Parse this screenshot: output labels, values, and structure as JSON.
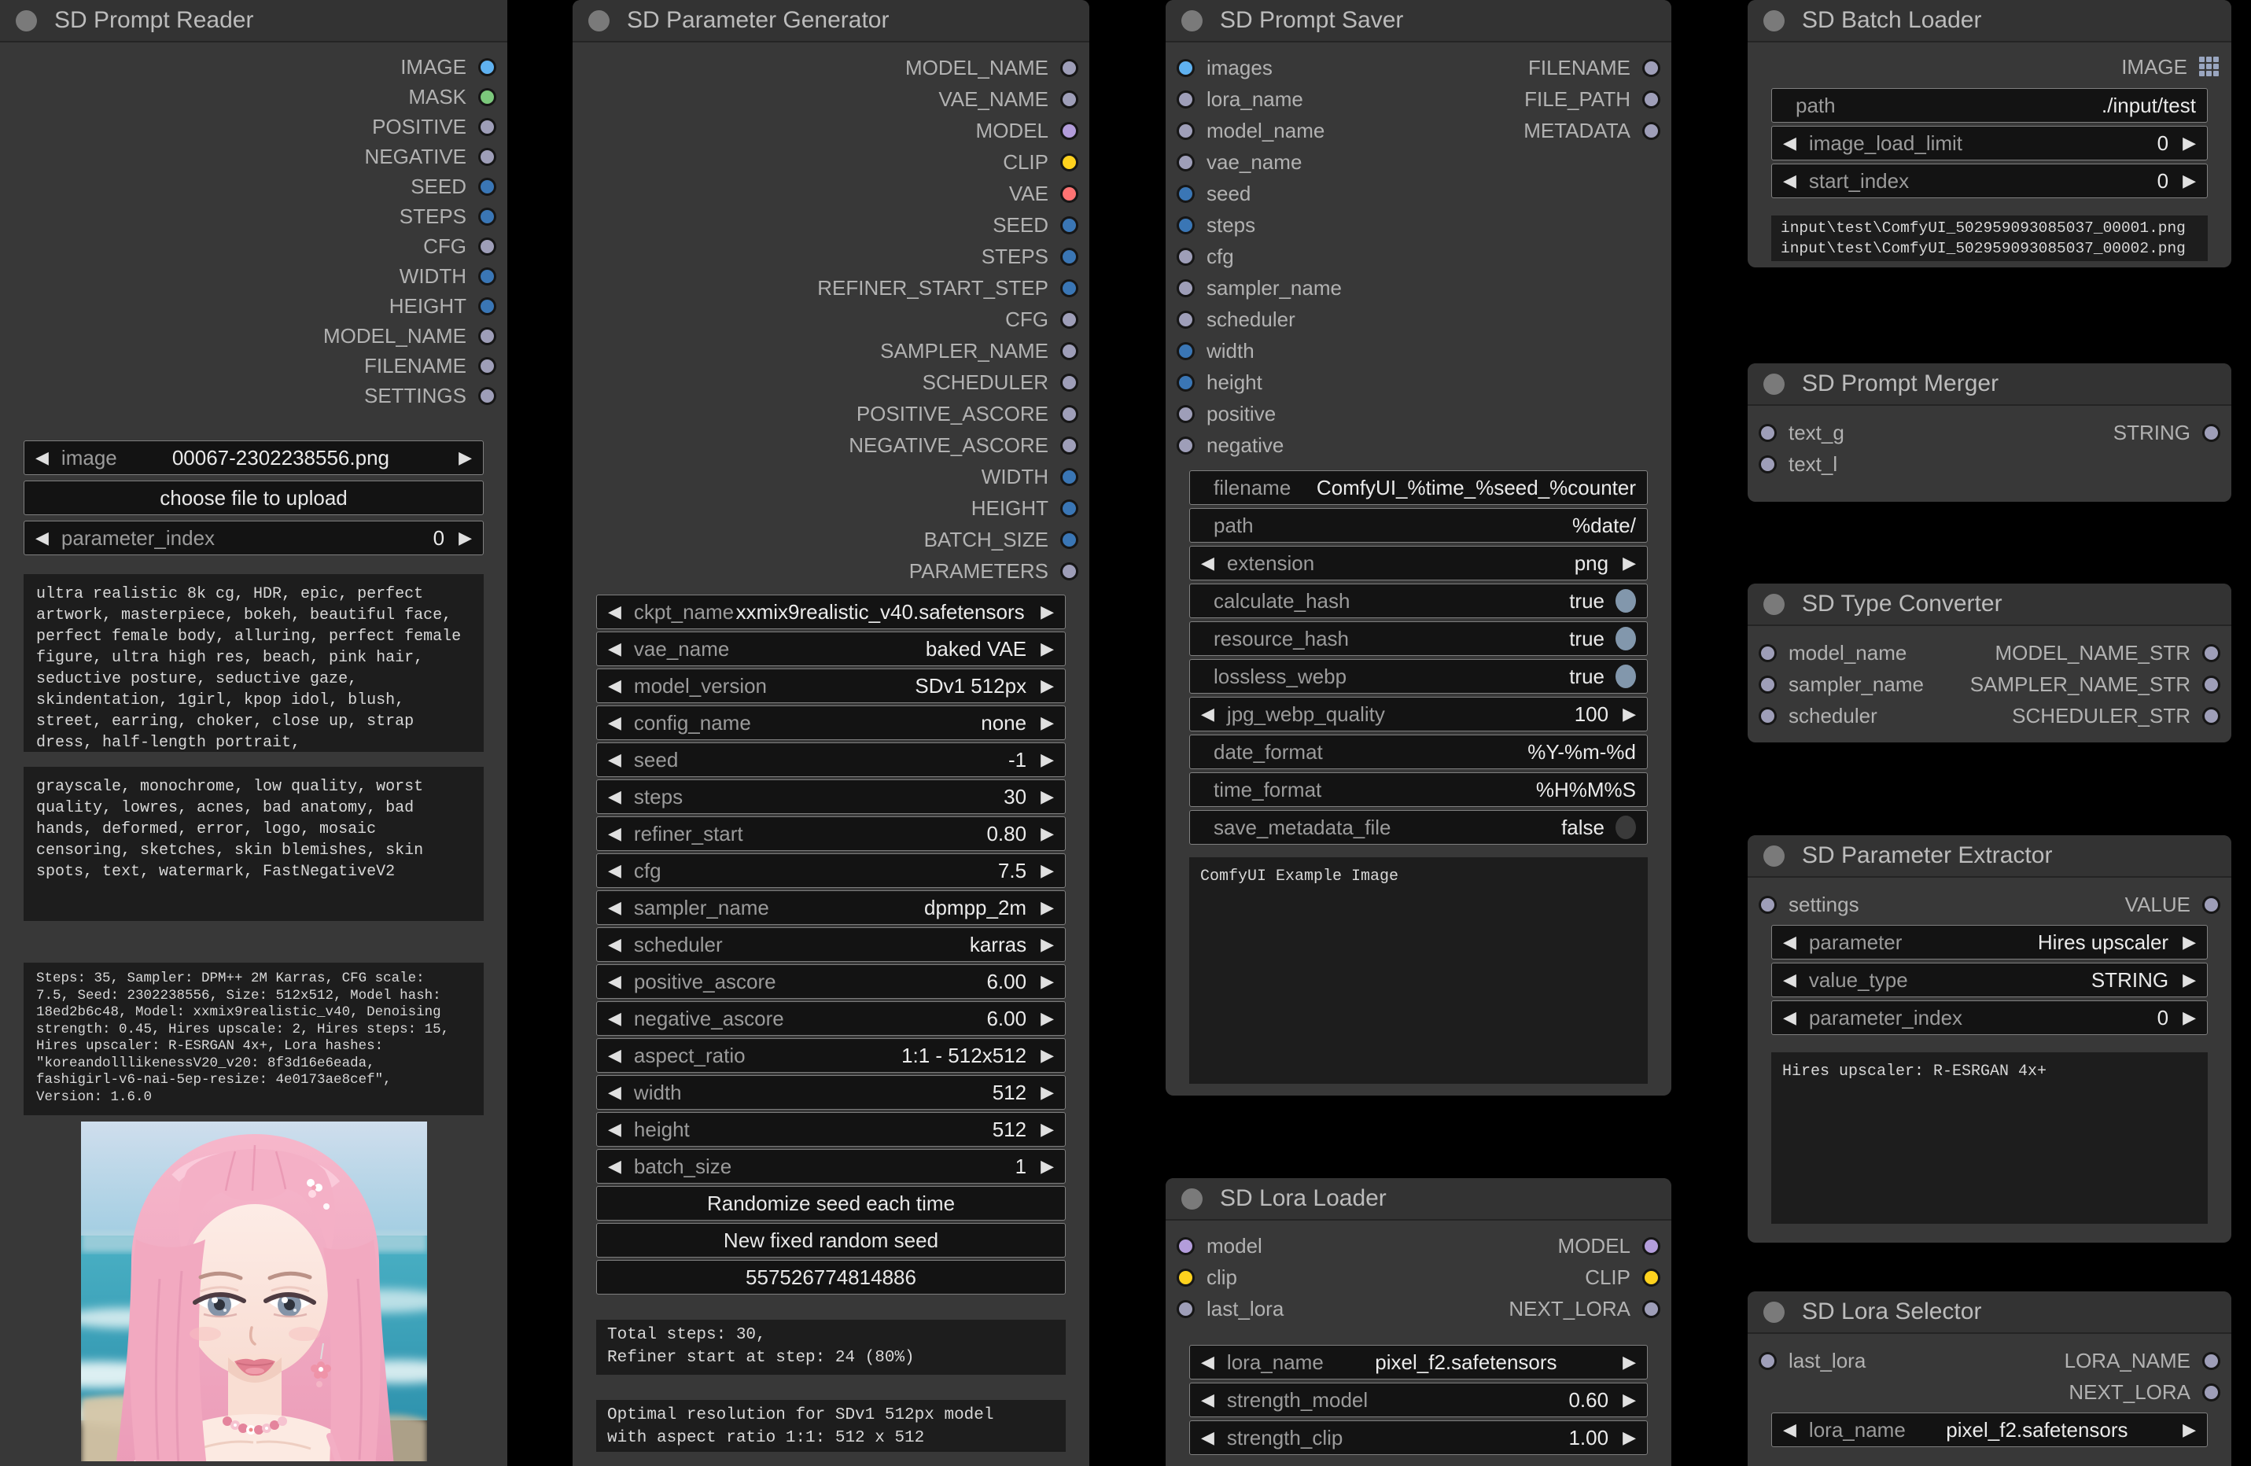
{
  "icons": {
    "arrow_left": "◀",
    "arrow_right": "▶"
  },
  "colors": {
    "title_dot": "background:#7a7a7a",
    "slot_image": "background:#5fb1f0",
    "slot_mask": "background:#7cc87c",
    "slot_string": "background:#9e9eb8",
    "slot_int": "background:#3a76b5",
    "slot_model": "background:#b39ddb",
    "slot_clip": "background:#ffd21e",
    "slot_vae": "background:#ff7373",
    "toggle_on": "background:#8297ac",
    "toggle_off": "background:#3a3a3a",
    "grid_icon": "color:#9aa6c0"
  },
  "nodes": {
    "reader": {
      "title": "SD Prompt Reader",
      "outputs": [
        "IMAGE",
        "MASK",
        "POSITIVE",
        "NEGATIVE",
        "SEED",
        "STEPS",
        "CFG",
        "WIDTH",
        "HEIGHT",
        "MODEL_NAME",
        "FILENAME",
        "SETTINGS"
      ],
      "widgets": {
        "image": {
          "label": "image",
          "value": "00067-2302238556.png"
        },
        "upload_button": "choose file to upload",
        "parameter_index": {
          "label": "parameter_index",
          "value": "0"
        }
      },
      "positive_text": "ultra realistic 8k cg, HDR, epic, perfect artwork, masterpiece, bokeh, beautiful face, perfect female body, alluring, perfect female figure, ultra high res, beach, pink hair, seductive posture, seductive gaze, skindentation, 1girl, kpop idol, blush, street, earring, choker, close up, strap dress, half-length portrait,",
      "negative_text": "grayscale, monochrome, low quality, worst quality, lowres, acnes, bad anatomy, bad hands, deformed, error, logo, mosaic censoring, sketches, skin blemishes, skin spots, text, watermark, FastNegativeV2",
      "settings_text": "Steps: 35, Sampler: DPM++ 2M Karras, CFG scale: 7.5, Seed: 2302238556, Size: 512x512, Model hash: 18ed2b6c48, Model: xxmix9realistic_v40, Denoising strength: 0.45, Hires upscale: 2, Hires steps: 15, Hires upscaler: R-ESRGAN 4x+, Lora hashes: \"koreandolllikenessV20_v20: 8f3d16e6eada, fashigirl-v6-nai-5ep-resize: 4e0173ae8cef\", Version: 1.6.0"
    },
    "generator": {
      "title": "SD Parameter Generator",
      "outputs": [
        "MODEL_NAME",
        "VAE_NAME",
        "MODEL",
        "CLIP",
        "VAE",
        "SEED",
        "STEPS",
        "REFINER_START_STEP",
        "CFG",
        "SAMPLER_NAME",
        "SCHEDULER",
        "POSITIVE_ASCORE",
        "NEGATIVE_ASCORE",
        "WIDTH",
        "HEIGHT",
        "BATCH_SIZE",
        "PARAMETERS"
      ],
      "widgets": {
        "ckpt_name": {
          "label": "ckpt_name",
          "value": "xxmix9realistic_v40.safetensors"
        },
        "vae_name": {
          "label": "vae_name",
          "value": "baked VAE"
        },
        "model_version": {
          "label": "model_version",
          "value": "SDv1 512px"
        },
        "config_name": {
          "label": "config_name",
          "value": "none"
        },
        "seed": {
          "label": "seed",
          "value": "-1"
        },
        "steps": {
          "label": "steps",
          "value": "30"
        },
        "refiner_start": {
          "label": "refiner_start",
          "value": "0.80"
        },
        "cfg": {
          "label": "cfg",
          "value": "7.5"
        },
        "sampler_name": {
          "label": "sampler_name",
          "value": "dpmpp_2m"
        },
        "scheduler": {
          "label": "scheduler",
          "value": "karras"
        },
        "positive_ascore": {
          "label": "positive_ascore",
          "value": "6.00"
        },
        "negative_ascore": {
          "label": "negative_ascore",
          "value": "6.00"
        },
        "aspect_ratio": {
          "label": "aspect_ratio",
          "value": "1:1 - 512x512"
        },
        "width": {
          "label": "width",
          "value": "512"
        },
        "height": {
          "label": "height",
          "value": "512"
        },
        "batch_size": {
          "label": "batch_size",
          "value": "1"
        }
      },
      "randomize_button": "Randomize seed each time",
      "new_seed_button": "New fixed random seed",
      "seed_value": "557526774814886",
      "steps_info": "Total steps: 30,\nRefiner start at step: 24 (80%)",
      "resolution_info": "Optimal resolution for SDv1 512px model\nwith aspect ratio 1:1: 512 x 512"
    },
    "saver": {
      "title": "SD Prompt Saver",
      "inputs": [
        "images",
        "lora_name",
        "model_name",
        "vae_name",
        "seed",
        "steps",
        "cfg",
        "sampler_name",
        "scheduler",
        "width",
        "height",
        "positive",
        "negative"
      ],
      "outputs": [
        "FILENAME",
        "FILE_PATH",
        "METADATA"
      ],
      "widgets": {
        "filename": {
          "label": "filename",
          "value": "ComfyUI_%time_%seed_%counter"
        },
        "path": {
          "label": "path",
          "value": "%date/"
        },
        "extension": {
          "label": "extension",
          "value": "png"
        },
        "calculate_hash": {
          "label": "calculate_hash",
          "value": "true"
        },
        "resource_hash": {
          "label": "resource_hash",
          "value": "true"
        },
        "lossless_webp": {
          "label": "lossless_webp",
          "value": "true"
        },
        "jpg_webp_quality": {
          "label": "jpg_webp_quality",
          "value": "100"
        },
        "date_format": {
          "label": "date_format",
          "value": "%Y-%m-%d"
        },
        "time_format": {
          "label": "time_format",
          "value": "%H%M%S"
        },
        "save_metadata_file": {
          "label": "save_metadata_file",
          "value": "false"
        }
      },
      "preview_text": "ComfyUI Example Image"
    },
    "lora_loader": {
      "title": "SD Lora Loader",
      "inputs": [
        "model",
        "clip",
        "last_lora"
      ],
      "outputs": [
        "MODEL",
        "CLIP",
        "NEXT_LORA"
      ],
      "widgets": {
        "lora_name": {
          "label": "lora_name",
          "value": "pixel_f2.safetensors"
        },
        "strength_model": {
          "label": "strength_model",
          "value": "0.60"
        },
        "strength_clip": {
          "label": "strength_clip",
          "value": "1.00"
        }
      }
    },
    "batch_loader": {
      "title": "SD Batch Loader",
      "output": "IMAGE",
      "widgets": {
        "path": {
          "label": "path",
          "value": "./input/test"
        },
        "image_load_limit": {
          "label": "image_load_limit",
          "value": "0"
        },
        "start_index": {
          "label": "start_index",
          "value": "0"
        }
      },
      "files_text": "input\\test\\ComfyUI_502959093085037_00001.png\ninput\\test\\ComfyUI_502959093085037_00002.png"
    },
    "merger": {
      "title": "SD Prompt Merger",
      "inputs": [
        "text_g",
        "text_l"
      ],
      "output": "STRING"
    },
    "converter": {
      "title": "SD Type Converter",
      "inputs": [
        "model_name",
        "sampler_name",
        "scheduler"
      ],
      "outputs": [
        "MODEL_NAME_STR",
        "SAMPLER_NAME_STR",
        "SCHEDULER_STR"
      ]
    },
    "extractor": {
      "title": "SD Parameter Extractor",
      "input": "settings",
      "output": "VALUE",
      "widgets": {
        "parameter": {
          "label": "parameter",
          "value": "Hires upscaler"
        },
        "value_type": {
          "label": "value_type",
          "value": "STRING"
        },
        "parameter_index": {
          "label": "parameter_index",
          "value": "0"
        }
      },
      "result_text": "Hires upscaler: R-ESRGAN 4x+"
    },
    "lora_selector": {
      "title": "SD Lora Selector",
      "input": "last_lora",
      "outputs": [
        "LORA_NAME",
        "NEXT_LORA"
      ],
      "widgets": {
        "lora_name": {
          "label": "lora_name",
          "value": "pixel_f2.safetensors"
        }
      }
    }
  }
}
